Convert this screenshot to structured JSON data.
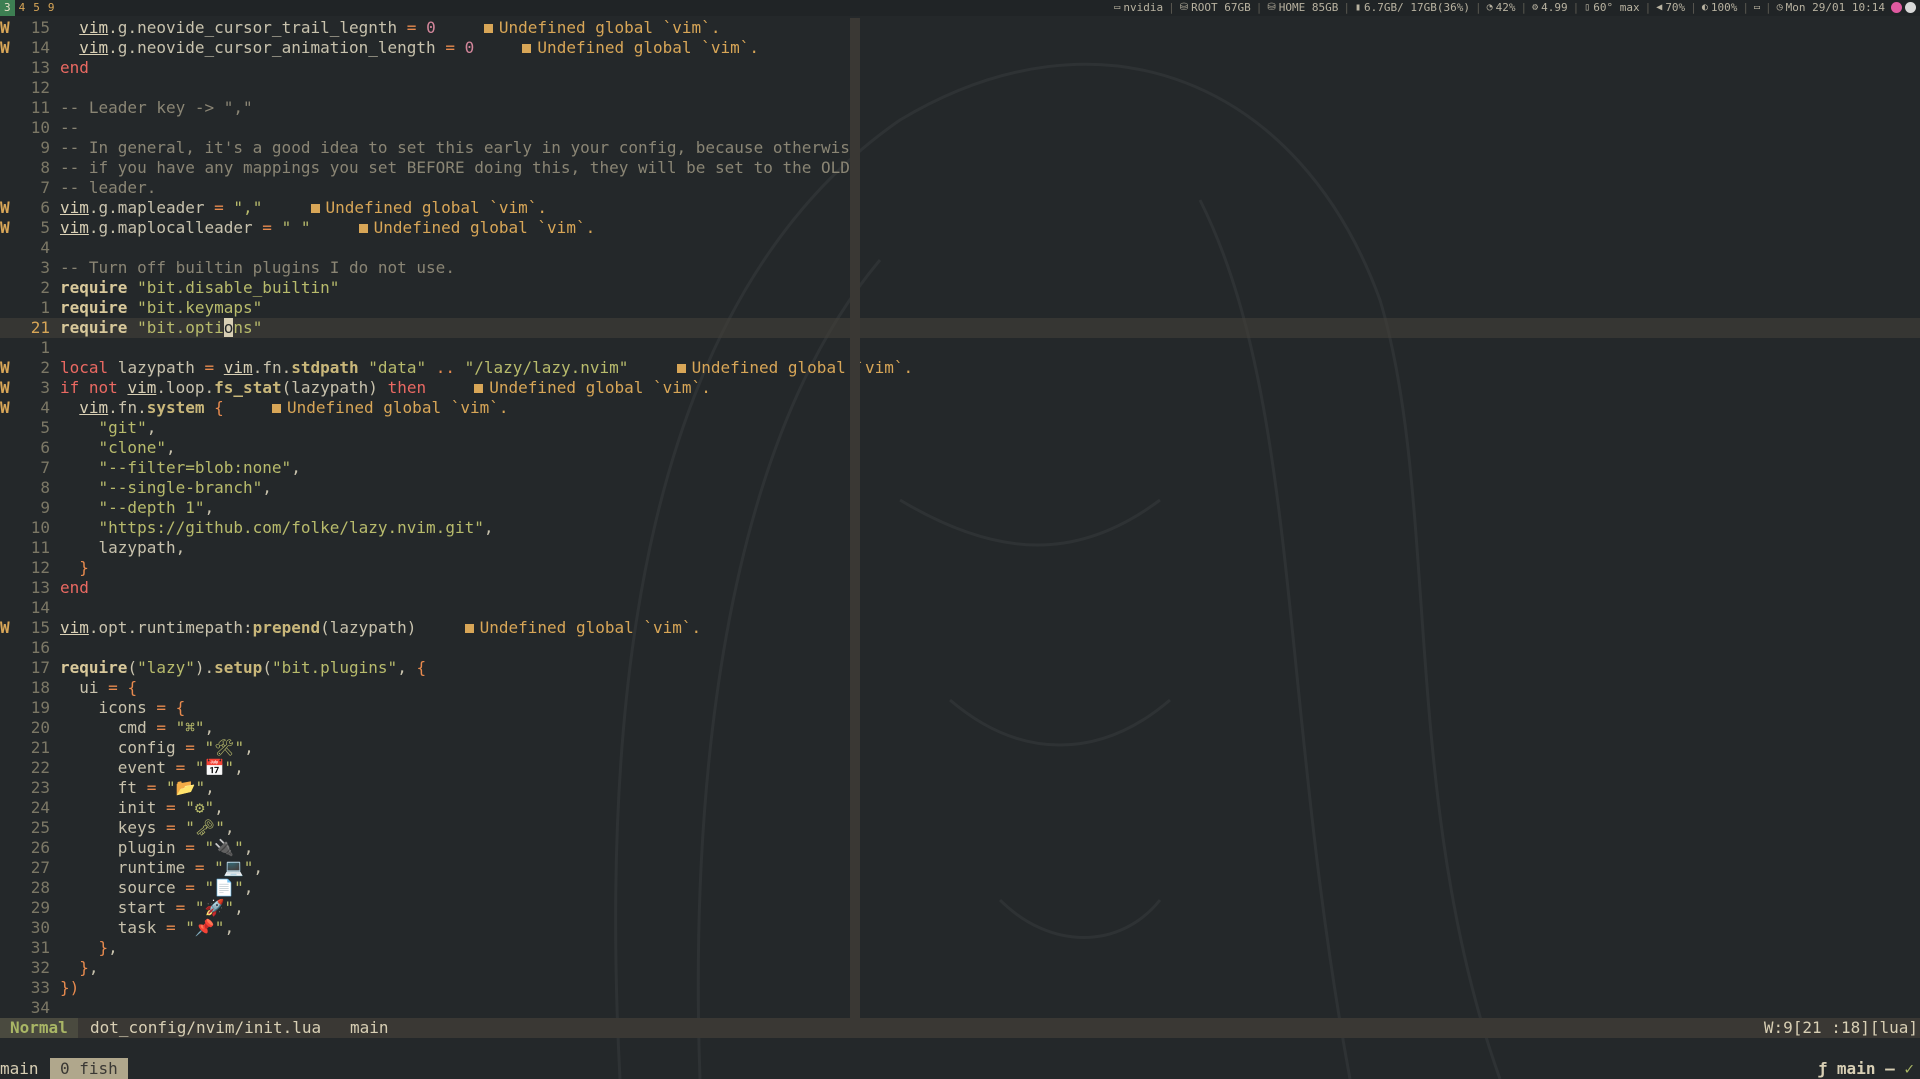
{
  "workspaces": [
    {
      "label": "3",
      "active": true
    },
    {
      "label": "4",
      "active": false
    },
    {
      "label": "5",
      "active": false
    },
    {
      "label": "9",
      "active": false
    }
  ],
  "system_status": [
    {
      "icon": "monitor-icon",
      "glyph": "▭",
      "text": "nvidia"
    },
    {
      "icon": "disk-icon",
      "glyph": "⛁",
      "text": "ROOT 67GB"
    },
    {
      "icon": "disk-icon",
      "glyph": "⛁",
      "text": "HOME 85GB"
    },
    {
      "icon": "memory-icon",
      "glyph": "▮",
      "text": "6.7GB/ 17GB(36%)"
    },
    {
      "icon": "cpu-icon",
      "glyph": "◔",
      "text": "42%"
    },
    {
      "icon": "load-icon",
      "glyph": "⚙",
      "text": "4.99"
    },
    {
      "icon": "temperature-icon",
      "glyph": "▯",
      "text": "60° max"
    },
    {
      "icon": "volume-icon",
      "glyph": "◀",
      "text": "70%"
    },
    {
      "icon": "brightness-icon",
      "glyph": "◐",
      "text": "100%"
    },
    {
      "icon": "battery-icon",
      "glyph": "▭",
      "text": ""
    },
    {
      "icon": "clock-icon",
      "glyph": "◷",
      "text": "Mon 29/01 10:14"
    }
  ],
  "tray_colors": [
    "#e05aa0",
    "#d8d8d8"
  ],
  "diagnostic_message": "Undefined global `vim`.",
  "buffer": {
    "lines": [
      {
        "sign": "W",
        "lnr": "15",
        "tokens": [
          [
            "  ",
            ""
          ],
          [
            "vim",
            "vim"
          ],
          [
            ".g.neovide_cursor_trail_legnth ",
            ""
          ],
          [
            "=",
            "op"
          ],
          [
            " ",
            ""
          ],
          [
            "0",
            "num"
          ]
        ],
        "diag": true
      },
      {
        "sign": "W",
        "lnr": "14",
        "tokens": [
          [
            "  ",
            ""
          ],
          [
            "vim",
            "vim"
          ],
          [
            ".g.neovide_cursor_animation_length ",
            ""
          ],
          [
            "=",
            "op"
          ],
          [
            " ",
            ""
          ],
          [
            "0",
            "num"
          ]
        ],
        "diag": true
      },
      {
        "sign": "",
        "lnr": "13",
        "tokens": [
          [
            "end",
            "kw"
          ]
        ]
      },
      {
        "sign": "",
        "lnr": "12",
        "tokens": []
      },
      {
        "sign": "",
        "lnr": "11",
        "tokens": [
          [
            "-- Leader key -> \",\"",
            "cmt"
          ]
        ]
      },
      {
        "sign": "",
        "lnr": "10",
        "tokens": [
          [
            "--",
            "cmt"
          ]
        ]
      },
      {
        "sign": "",
        "lnr": "9",
        "tokens": [
          [
            "-- In general, it's a good idea to set this early in your config, because otherwise",
            "cmt"
          ]
        ]
      },
      {
        "sign": "",
        "lnr": "8",
        "tokens": [
          [
            "-- if you have any mappings you set BEFORE doing this, they will be set to the OLD",
            "cmt"
          ]
        ]
      },
      {
        "sign": "",
        "lnr": "7",
        "tokens": [
          [
            "-- leader.",
            "cmt"
          ]
        ]
      },
      {
        "sign": "W",
        "lnr": "6",
        "tokens": [
          [
            "vim",
            "vim"
          ],
          [
            ".g.mapleader ",
            ""
          ],
          [
            "=",
            "op"
          ],
          [
            " ",
            ""
          ],
          [
            "\",\"",
            "str"
          ]
        ],
        "diag": true
      },
      {
        "sign": "W",
        "lnr": "5",
        "tokens": [
          [
            "vim",
            "vim"
          ],
          [
            ".g.maplocalleader ",
            ""
          ],
          [
            "=",
            "op"
          ],
          [
            " ",
            ""
          ],
          [
            "\" \"",
            "str"
          ]
        ],
        "diag": true
      },
      {
        "sign": "",
        "lnr": "4",
        "tokens": []
      },
      {
        "sign": "",
        "lnr": "3",
        "tokens": [
          [
            "-- Turn off builtin plugins I do not use.",
            "cmt"
          ]
        ]
      },
      {
        "sign": "",
        "lnr": "2",
        "tokens": [
          [
            "require",
            "kwb"
          ],
          [
            " ",
            ""
          ],
          [
            "\"bit.disable_builtin\"",
            "str"
          ]
        ]
      },
      {
        "sign": "",
        "lnr": "1",
        "tokens": [
          [
            "require",
            "kwb"
          ],
          [
            " ",
            ""
          ],
          [
            "\"bit.keymaps\"",
            "str"
          ]
        ]
      },
      {
        "sign": "",
        "lnr": "21",
        "current": true,
        "tokens": [
          [
            "require",
            "kwb"
          ],
          [
            " ",
            ""
          ],
          [
            "\"bit.opti",
            "str"
          ],
          [
            "o",
            "cursor"
          ],
          [
            "ns\"",
            "str"
          ]
        ]
      },
      {
        "sign": "",
        "lnr": "1",
        "tokens": []
      },
      {
        "sign": "W",
        "lnr": "2",
        "tokens": [
          [
            "local",
            "kw"
          ],
          [
            " lazypath ",
            ""
          ],
          [
            "=",
            "op"
          ],
          [
            " ",
            ""
          ],
          [
            "vim",
            "vim"
          ],
          [
            ".fn.",
            ""
          ],
          [
            "stdpath",
            "fn"
          ],
          [
            " ",
            ""
          ],
          [
            "\"data\"",
            "str"
          ],
          [
            " ",
            ""
          ],
          [
            "..",
            "op"
          ],
          [
            " ",
            ""
          ],
          [
            "\"/lazy/lazy.nvim\"",
            "str"
          ]
        ],
        "diag": true
      },
      {
        "sign": "W",
        "lnr": "3",
        "tokens": [
          [
            "if",
            "kw"
          ],
          [
            " ",
            ""
          ],
          [
            "not",
            "kw"
          ],
          [
            " ",
            ""
          ],
          [
            "vim",
            "vim"
          ],
          [
            ".loop.",
            ""
          ],
          [
            "fs_stat",
            "fn"
          ],
          [
            "(lazypath) ",
            ""
          ],
          [
            "then",
            "kw"
          ]
        ],
        "diag": true
      },
      {
        "sign": "W",
        "lnr": "4",
        "tokens": [
          [
            "  ",
            ""
          ],
          [
            "vim",
            "vim"
          ],
          [
            ".fn.",
            ""
          ],
          [
            "system",
            "fn"
          ],
          [
            " ",
            ""
          ],
          [
            "{",
            "op"
          ]
        ],
        "diag": true
      },
      {
        "sign": "",
        "lnr": "5",
        "tokens": [
          [
            "    ",
            ""
          ],
          [
            "\"git\"",
            "str"
          ],
          [
            ",",
            ""
          ]
        ]
      },
      {
        "sign": "",
        "lnr": "6",
        "tokens": [
          [
            "    ",
            ""
          ],
          [
            "\"clone\"",
            "str"
          ],
          [
            ",",
            ""
          ]
        ]
      },
      {
        "sign": "",
        "lnr": "7",
        "tokens": [
          [
            "    ",
            ""
          ],
          [
            "\"--filter=blob:none\"",
            "str"
          ],
          [
            ",",
            ""
          ]
        ]
      },
      {
        "sign": "",
        "lnr": "8",
        "tokens": [
          [
            "    ",
            ""
          ],
          [
            "\"--single-branch\"",
            "str"
          ],
          [
            ",",
            ""
          ]
        ]
      },
      {
        "sign": "",
        "lnr": "9",
        "tokens": [
          [
            "    ",
            ""
          ],
          [
            "\"--depth 1\"",
            "str"
          ],
          [
            ",",
            ""
          ]
        ]
      },
      {
        "sign": "",
        "lnr": "10",
        "tokens": [
          [
            "    ",
            ""
          ],
          [
            "\"https://github.com/folke/lazy.nvim.git\"",
            "str"
          ],
          [
            ",",
            ""
          ]
        ]
      },
      {
        "sign": "",
        "lnr": "11",
        "tokens": [
          [
            "    lazypath,",
            ""
          ]
        ]
      },
      {
        "sign": "",
        "lnr": "12",
        "tokens": [
          [
            "  ",
            ""
          ],
          [
            "}",
            "op"
          ]
        ]
      },
      {
        "sign": "",
        "lnr": "13",
        "tokens": [
          [
            "end",
            "kw"
          ]
        ]
      },
      {
        "sign": "",
        "lnr": "14",
        "tokens": []
      },
      {
        "sign": "W",
        "lnr": "15",
        "tokens": [
          [
            "vim",
            "vim"
          ],
          [
            ".opt.runtimepath:",
            ""
          ],
          [
            "prepend",
            "fn"
          ],
          [
            "(lazypath)",
            ""
          ]
        ],
        "diag": true
      },
      {
        "sign": "",
        "lnr": "16",
        "tokens": []
      },
      {
        "sign": "",
        "lnr": "17",
        "tokens": [
          [
            "require",
            "kwb"
          ],
          [
            "(",
            ""
          ],
          [
            "\"lazy\"",
            "str"
          ],
          [
            ").",
            ""
          ],
          [
            "setup",
            "fn"
          ],
          [
            "(",
            ""
          ],
          [
            "\"bit.plugins\"",
            "str"
          ],
          [
            ", ",
            ""
          ],
          [
            "{",
            "op"
          ]
        ]
      },
      {
        "sign": "",
        "lnr": "18",
        "tokens": [
          [
            "  ui ",
            ""
          ],
          [
            "=",
            "op"
          ],
          [
            " ",
            ""
          ],
          [
            "{",
            "op"
          ]
        ]
      },
      {
        "sign": "",
        "lnr": "19",
        "tokens": [
          [
            "    icons ",
            ""
          ],
          [
            "=",
            "op"
          ],
          [
            " ",
            ""
          ],
          [
            "{",
            "op"
          ]
        ]
      },
      {
        "sign": "",
        "lnr": "20",
        "tokens": [
          [
            "      cmd ",
            ""
          ],
          [
            "=",
            "op"
          ],
          [
            " ",
            ""
          ],
          [
            "\"⌘\"",
            "str"
          ],
          [
            ",",
            ""
          ]
        ]
      },
      {
        "sign": "",
        "lnr": "21",
        "tokens": [
          [
            "      config ",
            ""
          ],
          [
            "=",
            "op"
          ],
          [
            " ",
            ""
          ],
          [
            "\"🛠\"",
            "str"
          ],
          [
            ",",
            ""
          ]
        ]
      },
      {
        "sign": "",
        "lnr": "22",
        "tokens": [
          [
            "      event ",
            ""
          ],
          [
            "=",
            "op"
          ],
          [
            " ",
            ""
          ],
          [
            "\"📅\"",
            "str"
          ],
          [
            ",",
            ""
          ]
        ]
      },
      {
        "sign": "",
        "lnr": "23",
        "tokens": [
          [
            "      ft ",
            ""
          ],
          [
            "=",
            "op"
          ],
          [
            " ",
            ""
          ],
          [
            "\"📂\"",
            "str"
          ],
          [
            ",",
            ""
          ]
        ]
      },
      {
        "sign": "",
        "lnr": "24",
        "tokens": [
          [
            "      init ",
            ""
          ],
          [
            "=",
            "op"
          ],
          [
            " ",
            ""
          ],
          [
            "\"⚙\"",
            "str"
          ],
          [
            ",",
            ""
          ]
        ]
      },
      {
        "sign": "",
        "lnr": "25",
        "tokens": [
          [
            "      keys ",
            ""
          ],
          [
            "=",
            "op"
          ],
          [
            " ",
            ""
          ],
          [
            "\"🗝\"",
            "str"
          ],
          [
            ",",
            ""
          ]
        ]
      },
      {
        "sign": "",
        "lnr": "26",
        "tokens": [
          [
            "      plugin ",
            ""
          ],
          [
            "=",
            "op"
          ],
          [
            " ",
            ""
          ],
          [
            "\"🔌\"",
            "str"
          ],
          [
            ",",
            ""
          ]
        ]
      },
      {
        "sign": "",
        "lnr": "27",
        "tokens": [
          [
            "      runtime ",
            ""
          ],
          [
            "=",
            "op"
          ],
          [
            " ",
            ""
          ],
          [
            "\"💻\"",
            "str"
          ],
          [
            ",",
            ""
          ]
        ]
      },
      {
        "sign": "",
        "lnr": "28",
        "tokens": [
          [
            "      source ",
            ""
          ],
          [
            "=",
            "op"
          ],
          [
            " ",
            ""
          ],
          [
            "\"📄\"",
            "str"
          ],
          [
            ",",
            ""
          ]
        ]
      },
      {
        "sign": "",
        "lnr": "29",
        "tokens": [
          [
            "      start ",
            ""
          ],
          [
            "=",
            "op"
          ],
          [
            " ",
            ""
          ],
          [
            "\"🚀\"",
            "str"
          ],
          [
            ",",
            ""
          ]
        ]
      },
      {
        "sign": "",
        "lnr": "30",
        "tokens": [
          [
            "      task ",
            ""
          ],
          [
            "=",
            "op"
          ],
          [
            " ",
            ""
          ],
          [
            "\"📌\"",
            "str"
          ],
          [
            ",",
            ""
          ]
        ]
      },
      {
        "sign": "",
        "lnr": "31",
        "tokens": [
          [
            "    ",
            ""
          ],
          [
            "}",
            "op"
          ],
          [
            ",",
            ""
          ]
        ]
      },
      {
        "sign": "",
        "lnr": "32",
        "tokens": [
          [
            "  ",
            ""
          ],
          [
            "}",
            "op"
          ],
          [
            ",",
            ""
          ]
        ]
      },
      {
        "sign": "",
        "lnr": "33",
        "tokens": [
          [
            "})",
            "op"
          ]
        ]
      },
      {
        "sign": "",
        "lnr": "34",
        "tokens": []
      }
    ]
  },
  "statusline": {
    "mode": "Normal",
    "file": "dot_config/nvim/init.lua",
    "branch": "main",
    "right": "W:9[21 :18][lua]"
  },
  "tmux": {
    "session": "main",
    "window": "0 fish",
    "right_label": "main –",
    "right_icon": "git-icon",
    "right_glyph": "ƒ",
    "check": "✓"
  }
}
